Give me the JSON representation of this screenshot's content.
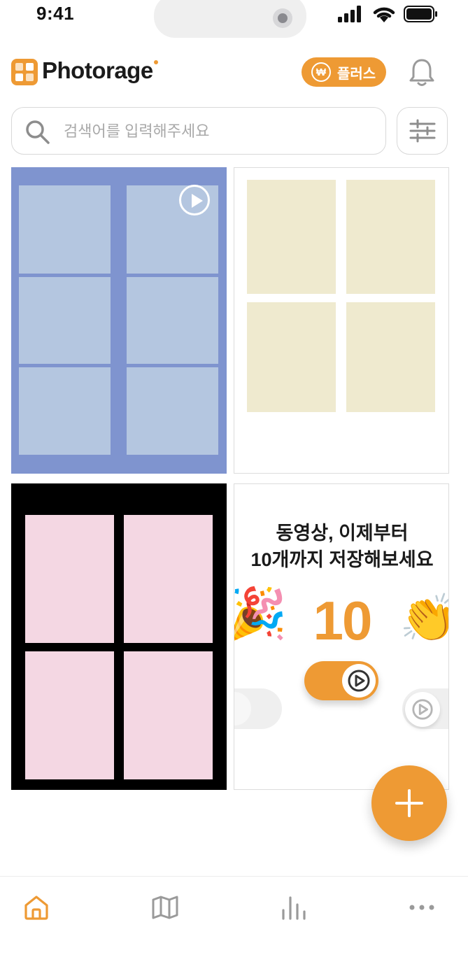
{
  "status_bar": {
    "time": "9:41"
  },
  "header": {
    "brand": "Photorage",
    "plus_button": {
      "currency": "₩",
      "label": "플러스"
    }
  },
  "search": {
    "placeholder": "검색어를 입력해주세요",
    "value": ""
  },
  "promo": {
    "line1": "동영상, 이제부터",
    "line2": "10개까지 저장해보세요",
    "count": "10",
    "emoji_left": "🎉",
    "emoji_right": "👏"
  },
  "icons": {
    "logo": "photorage-logo-icon",
    "bell": "bell-icon",
    "search": "search-icon",
    "filter": "filter-sliders-icon",
    "add": "plus-icon",
    "tabs": [
      "home-icon",
      "map-icon",
      "stats-bars-icon",
      "more-dots-icon"
    ]
  },
  "colors": {
    "accent": "#EE9A34",
    "active_tab": "#EE9A34",
    "inactive_tab": "#9A9A9A"
  },
  "tabs": {
    "active_index": 0
  }
}
